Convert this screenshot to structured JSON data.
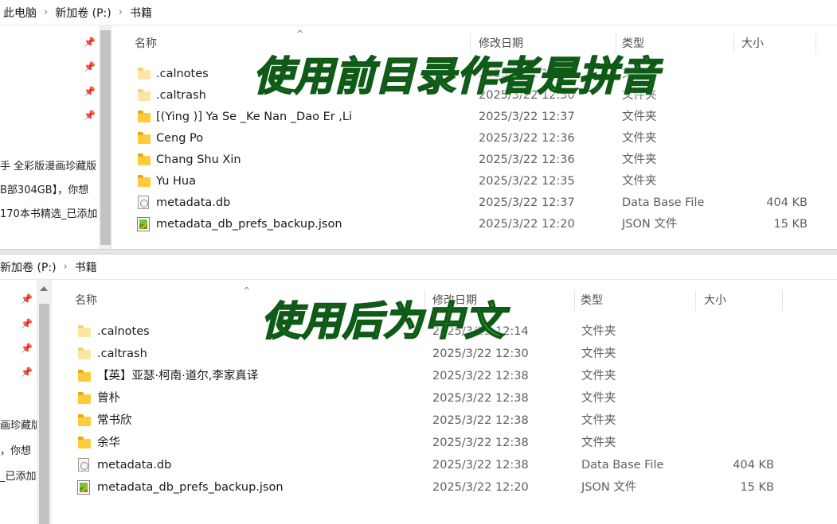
{
  "top": {
    "breadcrumb": [
      "此电脑",
      "新加卷 (P:)",
      "书籍"
    ],
    "columns": {
      "name": "名称",
      "date": "修改日期",
      "type": "类型",
      "size": "大小"
    },
    "nav_cut_lines": [
      "手 全彩版漫画珍藏版",
      "B部304GB】，你想",
      "170本书精选_已添加"
    ],
    "rows": [
      {
        "name": ".calnotes",
        "date": "2025/3/22 12:21",
        "type": "文件夹",
        "size": "",
        "icon": "folder-icon"
      },
      {
        "name": ".caltrash",
        "date": "2025/3/22 12:30",
        "type": "文件夹",
        "size": "",
        "icon": "folder-icon"
      },
      {
        "name": "[(Ying )] Ya Se _Ke Nan _Dao Er ,Li",
        "date": "2025/3/22 12:37",
        "type": "文件夹",
        "size": "",
        "icon": "folder-icon"
      },
      {
        "name": "Ceng Po",
        "date": "2025/3/22 12:36",
        "type": "文件夹",
        "size": "",
        "icon": "folder-icon"
      },
      {
        "name": "Chang Shu Xin",
        "date": "2025/3/22 12:36",
        "type": "文件夹",
        "size": "",
        "icon": "folder-icon"
      },
      {
        "name": "Yu Hua",
        "date": "2025/3/22 12:35",
        "type": "文件夹",
        "size": "",
        "icon": "folder-icon"
      },
      {
        "name": "metadata.db",
        "date": "2025/3/22 12:37",
        "type": "Data Base File",
        "size": "404 KB",
        "icon": "database-file-icon"
      },
      {
        "name": "metadata_db_prefs_backup.json",
        "date": "2025/3/22 12:20",
        "type": "JSON 文件",
        "size": "15 KB",
        "icon": "json-file-icon"
      }
    ],
    "overlay": "使用前目录作者是拼音"
  },
  "bottom": {
    "breadcrumb": [
      "新加卷 (P:)",
      "书籍"
    ],
    "columns": {
      "name": "名称",
      "date": "修改日期",
      "type": "类型",
      "size": "大小"
    },
    "nav_cut_lines": [
      "画珍藏版",
      "，你想",
      "_已添加"
    ],
    "rows": [
      {
        "name": ".calnotes",
        "date": "2025/3/22 12:14",
        "type": "文件夹",
        "size": "",
        "icon": "folder-icon"
      },
      {
        "name": ".caltrash",
        "date": "2025/3/22 12:30",
        "type": "文件夹",
        "size": "",
        "icon": "folder-icon"
      },
      {
        "name": "【英】亚瑟·柯南·道尔,李家真译",
        "date": "2025/3/22 12:38",
        "type": "文件夹",
        "size": "",
        "icon": "folder-icon"
      },
      {
        "name": "曾朴",
        "date": "2025/3/22 12:38",
        "type": "文件夹",
        "size": "",
        "icon": "folder-icon"
      },
      {
        "name": "常书欣",
        "date": "2025/3/22 12:38",
        "type": "文件夹",
        "size": "",
        "icon": "folder-icon"
      },
      {
        "name": "余华",
        "date": "2025/3/22 12:38",
        "type": "文件夹",
        "size": "",
        "icon": "folder-icon"
      },
      {
        "name": "metadata.db",
        "date": "2025/3/22 12:38",
        "type": "Data Base File",
        "size": "404 KB",
        "icon": "database-file-icon"
      },
      {
        "name": "metadata_db_prefs_backup.json",
        "date": "2025/3/22 12:20",
        "type": "JSON 文件",
        "size": "15 KB",
        "icon": "json-file-icon"
      }
    ],
    "overlay": "使用后为中文"
  }
}
